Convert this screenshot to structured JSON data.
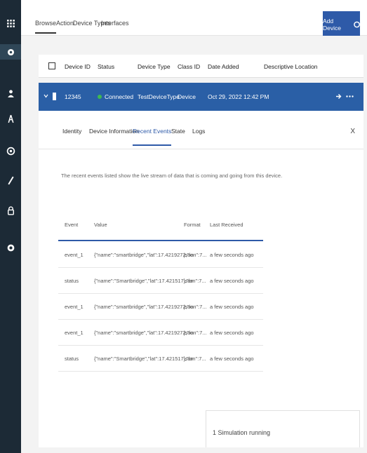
{
  "top_tabs": [
    "Browse",
    "Action",
    "Device Types",
    "Interfaces"
  ],
  "add_device_label": "Add Device",
  "table": {
    "headers": [
      "Device ID",
      "Status",
      "Device Type",
      "Class ID",
      "Date Added",
      "Descriptive Location"
    ],
    "selected_row": {
      "device_id": "12345",
      "status": "Connected",
      "device_type": "TestDeviceType",
      "class_id": "Device",
      "date_added": "Oct 29, 2022 12:42 PM"
    }
  },
  "detail": {
    "tabs": [
      "Identity",
      "Device Information",
      "Recent Events",
      "State",
      "Logs"
    ],
    "active_tab": "Recent Events",
    "close_label": "X",
    "description": "The recent events listed show the live stream of data that is coming and going from this device.",
    "events_headers": [
      "Event",
      "Value",
      "Format",
      "Last Received"
    ],
    "events": [
      {
        "event": "event_1",
        "value": "{\"name\":\"smartbridge\",\"lat\":17.4219272,\"lon\":7...",
        "format": "json",
        "last": "a few seconds ago"
      },
      {
        "event": "status",
        "value": "{\"name\":\"Smartbridge\",\"lat\":17.421517\\,\"lon\":7...",
        "format": "json",
        "last": "a few seconds ago"
      },
      {
        "event": "event_1",
        "value": "{\"name\":\"smartbridge\",\"lat\":17.4219272,\"lon\":7...",
        "format": "json",
        "last": "a few seconds ago"
      },
      {
        "event": "event_1",
        "value": "{\"name\":\"smartbridge\",\"lat\":17.4219272,\"lon\":7...",
        "format": "json",
        "last": "a few seconds ago"
      },
      {
        "event": "status",
        "value": "{\"name\":\"Smartbridge\",\"lat\":17.421517\\,\"lon\":7...",
        "format": "json",
        "last": "a few seconds ago"
      }
    ]
  },
  "simulation_label": "1 Simulation running",
  "colors": {
    "sidebar": "#1c2a36",
    "accent": "#2e5aa8",
    "selected_row": "#2a5fa6",
    "connected": "#3fb950"
  },
  "sidebar_icons": [
    "apps-grid-icon",
    "devices-icon",
    "members-icon",
    "apps-icon",
    "settings-wheel-icon",
    "rules-icon",
    "security-icon",
    "extensions-icon"
  ]
}
